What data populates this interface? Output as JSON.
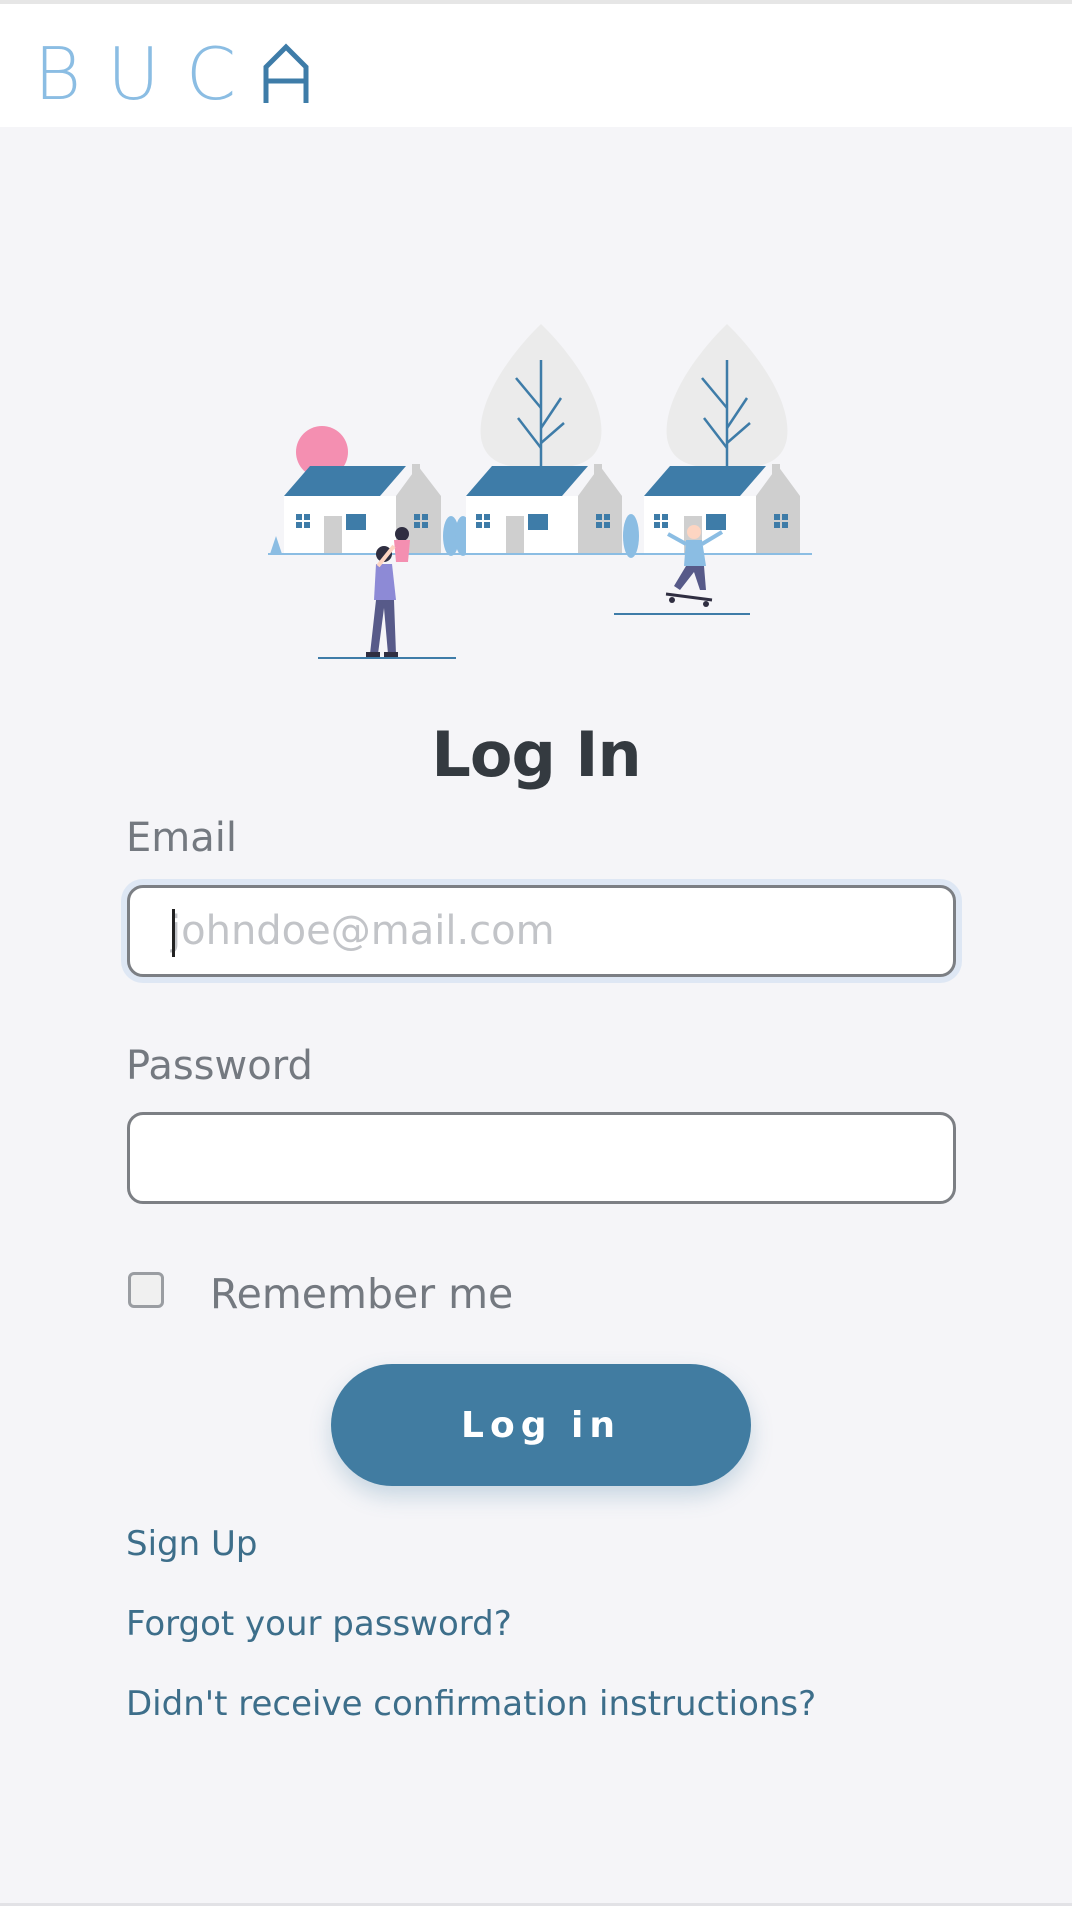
{
  "brand": {
    "name": "BUCA",
    "letters": "BUC",
    "last_letter": "A",
    "primary_color": "#417ca1",
    "logo_color": "#8bbde3"
  },
  "page": {
    "title": "Log In",
    "background": "#f5f5f8"
  },
  "form": {
    "email_label": "Email",
    "email_placeholder": "johndoe@mail.com",
    "email_value": "",
    "password_label": "Password",
    "password_value": "",
    "remember_label": "Remember me",
    "remember_checked": false,
    "submit_label": "Log in"
  },
  "links": {
    "sign_up": "Sign Up",
    "forgot_password": "Forgot your password?",
    "confirmation": "Didn't receive confirmation instructions?"
  },
  "illustration": {
    "icon": "neighborhood-houses-illustration"
  }
}
